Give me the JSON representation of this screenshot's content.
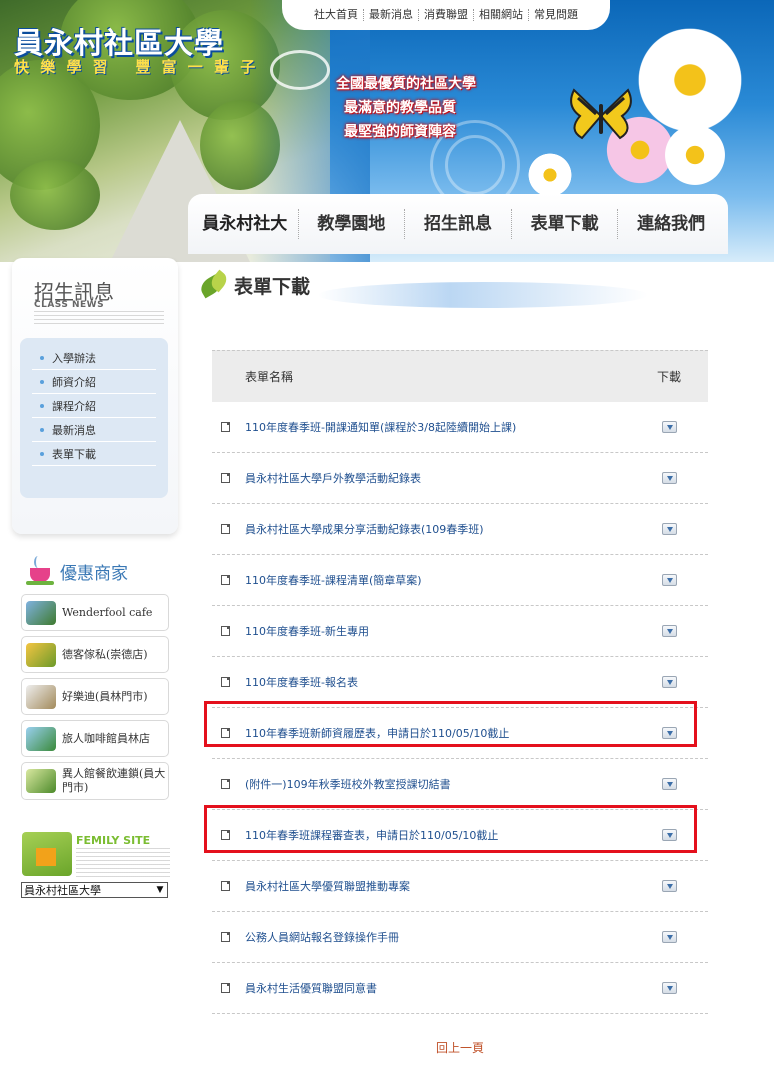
{
  "site": {
    "title": "員永村社區大學",
    "slogan": "快 樂 學 習   豐 富 一 輩 子"
  },
  "top_links": [
    "社大首頁",
    "最新消息",
    "消費聯盟",
    "相關網站",
    "常見問題"
  ],
  "promo": {
    "line1": "全國最優質的社區大學",
    "line2": "最滿意的教學品質",
    "line3": "最堅強的師資陣容"
  },
  "main_nav": [
    "員永村社大",
    "教學園地",
    "招生訊息",
    "表單下載",
    "連絡我們"
  ],
  "sidebar": {
    "title": "招生訊息",
    "subtitle": "CLASS NEWS",
    "menu": [
      "入學辦法",
      "師資介紹",
      "課程介紹",
      "最新消息",
      "表單下載"
    ]
  },
  "shops": {
    "title": "優惠商家",
    "items": [
      "Wenderfool cafe",
      "德客傢私(崇德店)",
      "好樂迪(員林門市)",
      "旅人咖啡館員林店",
      "異人館餐飲連鎖(員大門市)"
    ]
  },
  "family_site": {
    "label": "FEMILY SITE",
    "selected": "員永村社區大學"
  },
  "page": {
    "title": "表單下載"
  },
  "table": {
    "header_name": "表單名稱",
    "header_download": "下載",
    "rows": [
      "110年度春季班-開課通知單(課程於3/8起陸續開始上課)",
      "員永村社區大學戶外教學活動紀錄表",
      "員永村社區大學成果分享活動紀錄表(109春季班)",
      "110年度春季班-課程清單(簡章草案)",
      "110年度春季班-新生專用",
      "110年度春季班-報名表",
      "110年春季班新師資履歷表，申請日於110/05/10截止",
      "(附件一)109年秋季班校外教室授課切結書",
      "110年春季班課程審查表，申請日於110/05/10截止",
      "員永村社區大學優質聯盟推動專案",
      "公務人員網站報名登錄操作手冊",
      "員永村生活優質聯盟同意書"
    ]
  },
  "back_link": "回上一頁",
  "colors": {
    "highlight": "#e4101c",
    "link": "#1f4f8f",
    "banner_blue": "#0b67b8"
  }
}
